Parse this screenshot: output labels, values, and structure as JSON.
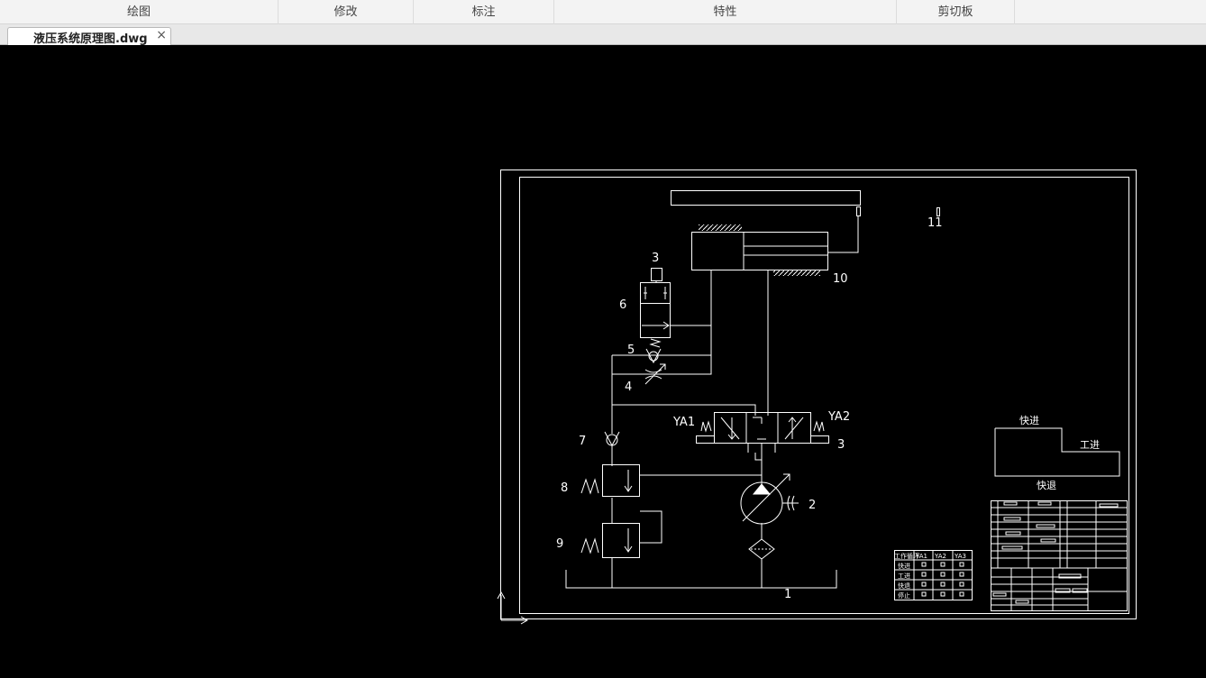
{
  "ribbon": {
    "panels": [
      "绘图",
      "修改",
      "标注",
      "特性",
      "剪切板"
    ]
  },
  "document": {
    "tab_title": "液压系统原理图.dwg",
    "close_glyph": "×"
  },
  "drawing": {
    "component_numbers": [
      "1",
      "2",
      "4",
      "5",
      "6",
      "7",
      "8",
      "9",
      "10",
      "11"
    ],
    "solenoids": [
      "YA1",
      "YA2"
    ],
    "symbol_3": "3",
    "symbol_w": "W",
    "cycle_diagram": {
      "fast_forward": "快进",
      "work_feed": "工进",
      "fast_return": "快退"
    },
    "action_table": {
      "header_cell": "工作循环",
      "columns": [
        "YA1",
        "YA2",
        "YA3"
      ],
      "rows": [
        "快进",
        "工进",
        "快退",
        "停止"
      ]
    }
  },
  "colors": {
    "canvas": "#000000",
    "line": "#ffffff",
    "ribbon_bg": "#f3f3f3"
  }
}
